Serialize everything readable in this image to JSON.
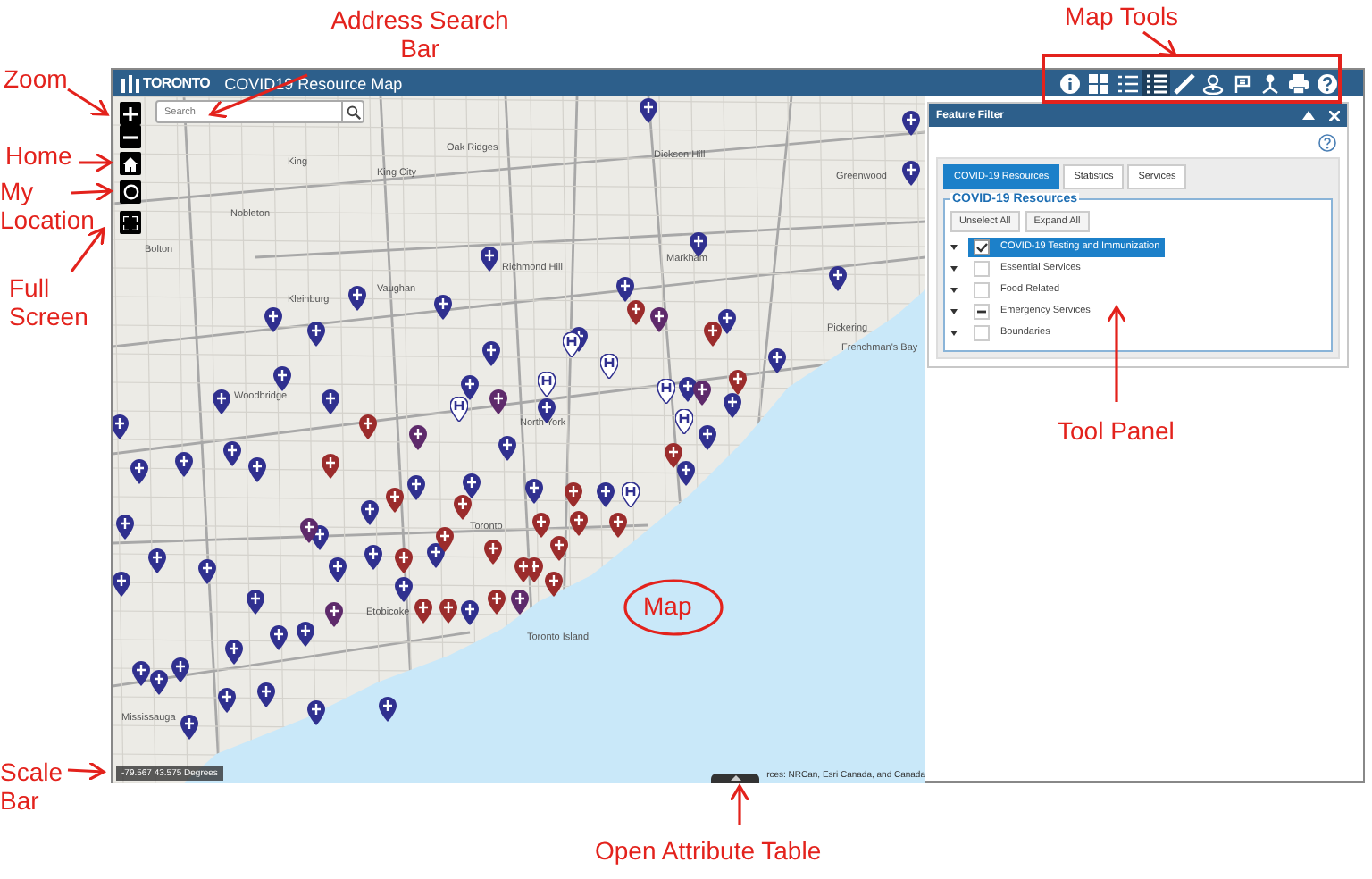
{
  "window": {
    "logo": "TORONTO",
    "title": "COVID19 Resource Map"
  },
  "map_tools": [
    {
      "kind": "info",
      "selected": false
    },
    {
      "kind": "grid",
      "selected": false
    },
    {
      "kind": "list",
      "selected": false
    },
    {
      "kind": "table",
      "selected": true
    },
    {
      "kind": "ruler",
      "selected": false
    },
    {
      "kind": "draw",
      "selected": false
    },
    {
      "kind": "pins",
      "selected": false
    },
    {
      "kind": "person",
      "selected": false
    },
    {
      "kind": "print",
      "selected": false
    },
    {
      "kind": "help",
      "selected": false
    }
  ],
  "search": {
    "placeholder": "Search"
  },
  "map": {
    "place_labels": [
      "King",
      "King City",
      "Oak Ridges",
      "Nobleton",
      "Bolton",
      "Vaughan",
      "Kleinburg",
      "Richmond Hill",
      "Markham",
      "Dickson Hill",
      "Greenwood",
      "Pickering",
      "Frenchman's Bay",
      "Woodbridge",
      "North York",
      "Toronto",
      "Etobicoke",
      "Toronto Island",
      "Mississauga"
    ],
    "coordinates": "-79.567 43.575 Degrees",
    "attribution": "rces: NRCan, Esri Canada, and Canada"
  },
  "panel": {
    "title": "Feature Filter",
    "tabs": [
      {
        "label": "COVID-19 Resources",
        "selected": true
      },
      {
        "label": "Statistics",
        "selected": false
      },
      {
        "label": "Services",
        "selected": false
      }
    ],
    "group_title": "COVID-19 Resources",
    "buttons": [
      "Unselect All",
      "Expand All"
    ],
    "layers": [
      {
        "label": "COVID-19 Testing and Immunization",
        "checked": true,
        "partial": false,
        "selected": true
      },
      {
        "label": "Essential Services",
        "checked": false,
        "partial": false,
        "selected": false
      },
      {
        "label": "Food Related",
        "checked": false,
        "partial": false,
        "selected": false
      },
      {
        "label": "Emergency Services",
        "checked": false,
        "partial": true,
        "selected": false
      },
      {
        "label": "Boundaries",
        "checked": false,
        "partial": false,
        "selected": false
      }
    ]
  },
  "annotations": [
    {
      "kind": "search",
      "text": "Address Search Bar"
    },
    {
      "kind": "tools",
      "text": "Map Tools"
    },
    {
      "kind": "zoom",
      "text": "Zoom"
    },
    {
      "kind": "home",
      "text": "Home"
    },
    {
      "kind": "location",
      "text": "My Location"
    },
    {
      "kind": "fullscreen",
      "text": "Full Screen"
    },
    {
      "kind": "panel",
      "text": "Tool Panel"
    },
    {
      "kind": "map",
      "text": "Map"
    },
    {
      "kind": "scale",
      "text": "Scale Bar"
    },
    {
      "kind": "table",
      "text": "Open Attribute Table"
    }
  ]
}
